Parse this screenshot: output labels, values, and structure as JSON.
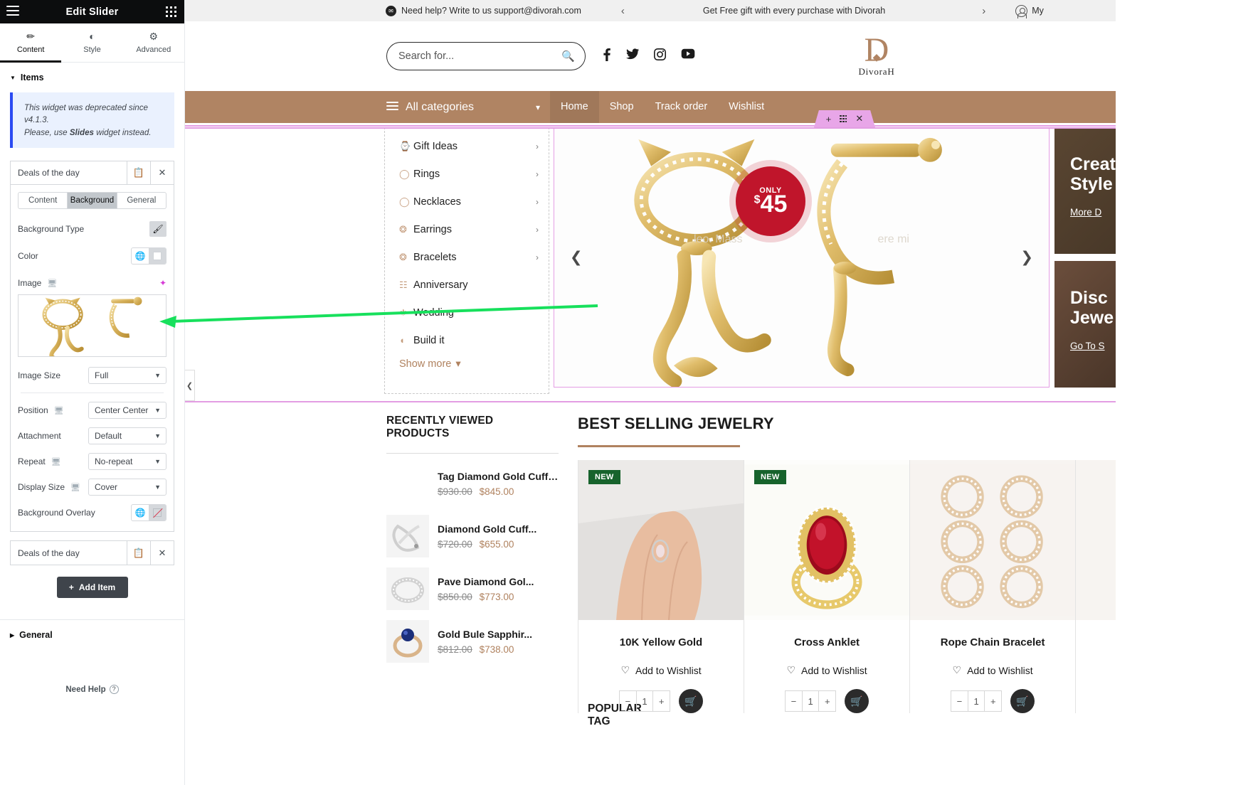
{
  "panel": {
    "title": "Edit Slider",
    "menu_icon": "hamburger-icon",
    "apps_icon": "grid-dots-icon",
    "tabs": [
      {
        "label": "Content",
        "icon": "pencil-icon",
        "active": true
      },
      {
        "label": "Style",
        "icon": "contrast-icon",
        "active": false
      },
      {
        "label": "Advanced",
        "icon": "gear-icon",
        "active": false
      }
    ],
    "items_section": {
      "label": "Items",
      "notice_line1": "This widget was deprecated since v4.1.3.",
      "notice_line2_pre": "Please, use ",
      "notice_bold": "Slides",
      "notice_line2_post": " widget instead."
    },
    "repeater_item_1": {
      "title": "Deals of the day",
      "duplicate_icon": "copy-icon",
      "remove_icon": "close-icon",
      "tabs": [
        "Content",
        "Background",
        "General"
      ],
      "active_tab": "Background",
      "controls": {
        "background_type_label": "Background Type",
        "background_type_icon": "brush-icon",
        "color_label": "Color",
        "color_globe_icon": "globe-icon",
        "image_label": "Image",
        "image_device_icon": "monitor-icon",
        "image_ai_icon": "ai-sparkle-icon",
        "image_size_label": "Image Size",
        "image_size_value": "Full",
        "position_label": "Position",
        "position_value": "Center Center",
        "attachment_label": "Attachment",
        "attachment_value": "Default",
        "repeat_label": "Repeat",
        "repeat_value": "No-repeat",
        "display_size_label": "Display Size",
        "display_size_value": "Cover",
        "background_overlay_label": "Background Overlay",
        "overlay_globe_icon": "globe-icon",
        "overlay_none_icon": "no-color-icon"
      }
    },
    "repeater_item_2": {
      "title": "Deals of the day",
      "duplicate_icon": "copy-icon",
      "remove_icon": "close-icon"
    },
    "add_item_label": "Add Item",
    "add_item_icon": "plus-icon",
    "general_section_label": "General",
    "need_help_label": "Need Help",
    "need_help_icon": "question-circle-icon"
  },
  "site": {
    "topbar": {
      "mail_icon": "envelope-icon",
      "support_text": "Need help? Write to us support@divorah.com",
      "prev_icon": "chevron-left-icon",
      "promo_text": "Get Free gift with every purchase with Divorah",
      "next_icon": "chevron-right-icon",
      "account_icon": "user-icon",
      "account_label": "My"
    },
    "header": {
      "search_placeholder": "Search for...",
      "search_icon": "search-icon",
      "socials": [
        "facebook-icon",
        "twitter-icon",
        "instagram-icon",
        "youtube-icon"
      ],
      "logo_letter": "D",
      "logo_diamond": "diamond-icon",
      "logo_name": "DivoraH"
    },
    "nav": {
      "all_categories": "All categories",
      "menu_icon": "hamburger-icon",
      "chevron_icon": "chevron-down-icon",
      "links": [
        {
          "label": "Home",
          "active": true
        },
        {
          "label": "Shop",
          "active": false
        },
        {
          "label": "Track order",
          "active": false
        },
        {
          "label": "Wishlist",
          "active": false
        }
      ]
    },
    "mega_menu": {
      "items": [
        {
          "label": "Gift Ideas",
          "icon": "watch-icon",
          "chevron": true
        },
        {
          "label": "Rings",
          "icon": "ring-icon",
          "chevron": true
        },
        {
          "label": "Necklaces",
          "icon": "necklace-icon",
          "chevron": true
        },
        {
          "label": "Earrings",
          "icon": "earrings-icon",
          "chevron": true
        },
        {
          "label": "Bracelets",
          "icon": "bracelet-icon",
          "chevron": true
        },
        {
          "label": "Anniversary",
          "icon": "gift-box-icon",
          "chevron": false
        },
        {
          "label": "Wedding",
          "icon": "wedding-icon",
          "chevron": false
        },
        {
          "label": "Build it",
          "icon": "build-icon",
          "chevron": false
        }
      ],
      "show_more": "Show more",
      "show_more_icon": "chevron-down-icon"
    },
    "hero": {
      "prev_icon": "chevron-left-icon",
      "next_icon": "chevron-right-icon",
      "badge_only": "ONLY",
      "badge_currency": "$",
      "badge_price": "45",
      "overlay_text_left": "leo. Mass",
      "overlay_text_right": "ere mi"
    },
    "promos": [
      {
        "title_line1": "Create",
        "title_line2": "Style",
        "link": "More D"
      },
      {
        "title_line1": "Disc",
        "title_line2": "Jewe",
        "link": "Go To S"
      }
    ],
    "elementor_handle": {
      "add_icon": "plus-icon",
      "drag_icon": "drag-dots-icon",
      "close_icon": "close-icon"
    },
    "collapse_tab_icon": "chevron-left-icon",
    "recently_viewed": {
      "title": "RECENTLY VIEWED PRODUCTS",
      "items": [
        {
          "name": "Tag Diamond Gold Cuff Ban...",
          "old_price": "$930.00",
          "new_price": "$845.00"
        },
        {
          "name": "Diamond Gold Cuff...",
          "old_price": "$720.00",
          "new_price": "$655.00"
        },
        {
          "name": "Pave Diamond Gol...",
          "old_price": "$850.00",
          "new_price": "$773.00"
        },
        {
          "name": "Gold Bule Sapphir...",
          "old_price": "$812.00",
          "new_price": "$738.00"
        }
      ],
      "popular_tag_title": "POPULAR TAG"
    },
    "best_selling": {
      "title": "BEST SELLING JEWELRY",
      "products": [
        {
          "name": "10K Yellow Gold",
          "badge": "NEW",
          "wishlist": "Add to Wishlist",
          "qty": "1",
          "cart_icon": "cart-icon"
        },
        {
          "name": "Cross Anklet",
          "badge": "NEW",
          "wishlist": "Add to Wishlist",
          "qty": "1",
          "cart_icon": "cart-icon"
        },
        {
          "name": "Rope Chain Bracelet",
          "badge": "",
          "wishlist": "Add to Wishlist",
          "qty": "1",
          "cart_icon": "cart-icon"
        }
      ],
      "wishlist_icon": "heart-icon"
    },
    "colors": {
      "nav_brown": "#b08463",
      "accent_gold": "#b0825f",
      "badge_red": "#c0152b",
      "badge_green": "#17632c",
      "elementor_pink": "#e39de3",
      "annotation_green": "#17e05c"
    }
  }
}
